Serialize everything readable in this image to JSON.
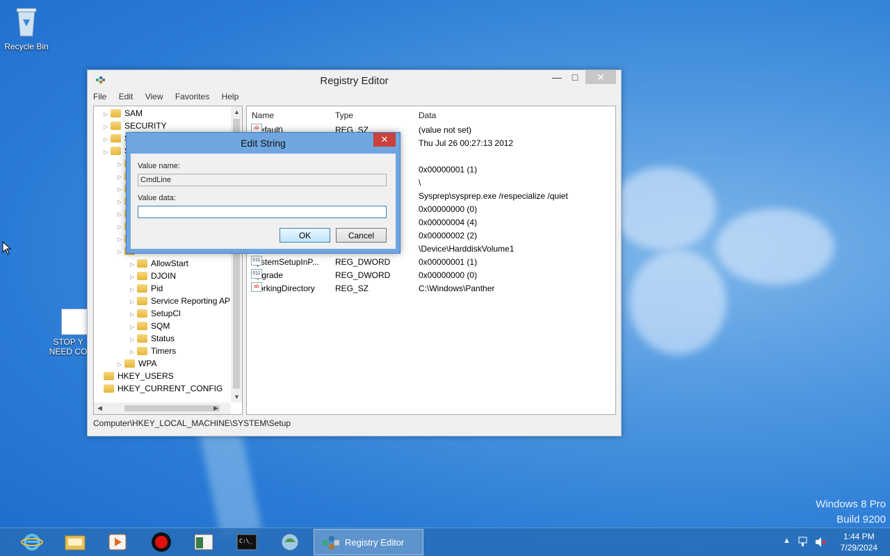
{
  "desktop": {
    "recycle_bin_label": "Recycle Bin",
    "shortcut_label_line1": "STOP Y",
    "shortcut_label_line2": "NEED CO",
    "watermark_line1": "Windows 8 Pro",
    "watermark_line2": "Build 9200"
  },
  "window": {
    "title": "Registry Editor",
    "menu": [
      "File",
      "Edit",
      "View",
      "Favorites",
      "Help"
    ],
    "status_path": "Computer\\HKEY_LOCAL_MACHINE\\SYSTEM\\Setup"
  },
  "tree": {
    "items": [
      {
        "label": "SAM",
        "indent": 1
      },
      {
        "label": "SECURITY",
        "indent": 1
      },
      {
        "label": "S",
        "indent": 1
      },
      {
        "label": "S",
        "indent": 1
      },
      {
        "label": "",
        "indent": 2
      },
      {
        "label": "",
        "indent": 2
      },
      {
        "label": "",
        "indent": 2
      },
      {
        "label": "",
        "indent": 2
      },
      {
        "label": "",
        "indent": 2
      },
      {
        "label": "",
        "indent": 2
      },
      {
        "label": "",
        "indent": 2
      },
      {
        "label": "",
        "indent": 2
      },
      {
        "label": "AllowStart",
        "indent": 3
      },
      {
        "label": "DJOIN",
        "indent": 3
      },
      {
        "label": "Pid",
        "indent": 3
      },
      {
        "label": "Service Reporting API",
        "indent": 3
      },
      {
        "label": "SetupCl",
        "indent": 3
      },
      {
        "label": "SQM",
        "indent": 3
      },
      {
        "label": "Status",
        "indent": 3
      },
      {
        "label": "Timers",
        "indent": 3
      },
      {
        "label": "WPA",
        "indent": 2
      },
      {
        "label": "HKEY_USERS",
        "indent": 0
      },
      {
        "label": "HKEY_CURRENT_CONFIG",
        "indent": 0
      }
    ]
  },
  "list": {
    "headers": {
      "name": "Name",
      "type": "Type",
      "data": "Data"
    },
    "rows": [
      {
        "name": "(Default)",
        "type": "REG_SZ",
        "data": "(value not set)",
        "icon": "ab"
      },
      {
        "name": "",
        "type": "",
        "data": "Thu Jul 26 00:27:13 2012",
        "icon": ""
      },
      {
        "name": "",
        "type": "",
        "data": "",
        "icon": ""
      },
      {
        "name": "",
        "type": "",
        "data": "0x00000001 (1)",
        "icon": ""
      },
      {
        "name": "",
        "type": "",
        "data": "\\",
        "icon": ""
      },
      {
        "name": "",
        "type": "",
        "data": "Sysprep\\sysprep.exe /respecialize /quiet",
        "icon": ""
      },
      {
        "name": "",
        "type": "",
        "data": "0x00000000 (0)",
        "icon": ""
      },
      {
        "name": "",
        "type": "",
        "data": "0x00000004 (4)",
        "icon": ""
      },
      {
        "name": "",
        "type": "",
        "data": "0x00000002 (2)",
        "icon": ""
      },
      {
        "name": "",
        "type": "",
        "data": "\\Device\\HarddiskVolume1",
        "icon": ""
      },
      {
        "name": "SystemSetupInP...",
        "type": "REG_DWORD",
        "data": "0x00000001 (1)",
        "icon": "dw"
      },
      {
        "name": "Upgrade",
        "type": "REG_DWORD",
        "data": "0x00000000 (0)",
        "icon": "dw"
      },
      {
        "name": "WorkingDirectory",
        "type": "REG_SZ",
        "data": "C:\\Windows\\Panther",
        "icon": "ab"
      }
    ]
  },
  "dialog": {
    "title": "Edit String",
    "value_name_label": "Value name:",
    "value_name": "CmdLine",
    "value_data_label": "Value data:",
    "value_data": "",
    "ok_label": "OK",
    "cancel_label": "Cancel"
  },
  "taskbar": {
    "active_label": "Registry Editor",
    "time": "1:44 PM",
    "date": "7/29/2024"
  }
}
